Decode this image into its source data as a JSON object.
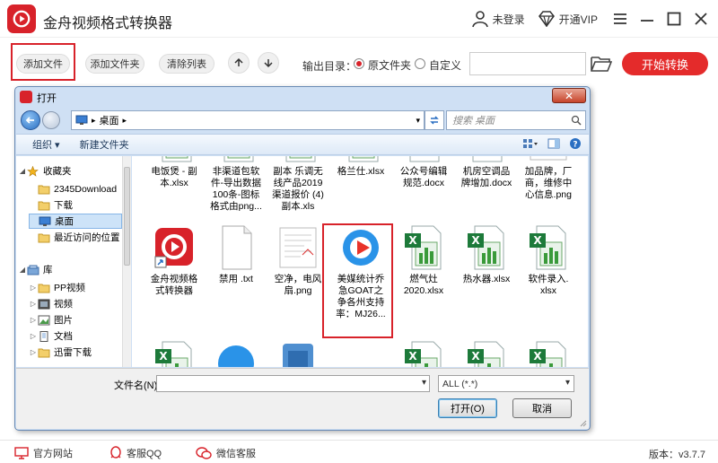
{
  "app": {
    "title": "金舟视频格式转换器",
    "login_label": "未登录",
    "vip_label": "开通VIP"
  },
  "toolbar": {
    "add_file": "添加文件",
    "add_folder": "添加文件夹",
    "clear_list": "清除列表",
    "output_label": "输出目录：",
    "radio_original": "原文件夹",
    "radio_custom": "自定义",
    "path_value": "",
    "start": "开始转换"
  },
  "dialog": {
    "title": "打开",
    "address": "桌面",
    "search_placeholder": "搜索 桌面",
    "organize": "组织 ▾",
    "new_folder": "新建文件夹",
    "nav": [
      {
        "label": "收藏夹",
        "level": 0,
        "expander": "◢"
      },
      {
        "label": "2345Download",
        "level": 1
      },
      {
        "label": "下载",
        "level": 1
      },
      {
        "label": "桌面",
        "level": 1,
        "selected": true
      },
      {
        "label": "最近访问的位置",
        "level": 1
      },
      {
        "label": "库",
        "level": 0,
        "expander": "◢"
      },
      {
        "label": "PP视频",
        "level": 1,
        "expander": "▷"
      },
      {
        "label": "视频",
        "level": 1,
        "expander": "▷"
      },
      {
        "label": "图片",
        "level": 1,
        "expander": "▷"
      },
      {
        "label": "文档",
        "level": 1,
        "expander": "▷"
      },
      {
        "label": "迅雷下载",
        "level": 1,
        "expander": "▷"
      }
    ],
    "files_row1": [
      {
        "label": "电饭煲 - 副\n本.xlsx",
        "type": "excel"
      },
      {
        "label": "非渠道包软\n件-导出数据\n100条-图标\n格式由png...",
        "type": "excel"
      },
      {
        "label": "副本 乐调无\n线产品2019\n渠道报价 (4)\n副本.xls",
        "type": "excel"
      },
      {
        "label": "格兰仕.xlsx",
        "type": "excel"
      },
      {
        "label": "公众号编辑\n规范.docx",
        "type": "word"
      },
      {
        "label": "机房空调品\n牌增加.docx",
        "type": "word"
      },
      {
        "label": "加品牌，厂\n商，维修中\n心信息.png",
        "type": "image"
      }
    ],
    "files_row2": [
      {
        "label": "金舟视频格\n式转换器",
        "type": "app"
      },
      {
        "label": "禁用 .txt",
        "type": "text"
      },
      {
        "label": "空净，电风\n扇.png",
        "type": "image"
      },
      {
        "label": "美媒统计乔\n急GOAT之\n争各州支持\n率：MJ26...",
        "type": "video"
      },
      {
        "label": "燃气灶\n2020.xlsx",
        "type": "excel"
      },
      {
        "label": "热水器.xlsx",
        "type": "excel"
      },
      {
        "label": "软件录入.\nxlsx",
        "type": "excel"
      }
    ],
    "filename_label": "文件名(N):",
    "filename_value": "",
    "filter": "ALL (*.*)",
    "open_btn": "打开(O)",
    "cancel_btn": "取消"
  },
  "statusbar": {
    "website": "官方网站",
    "qq": "客服QQ",
    "wechat": "微信客服",
    "version": "版本：v3.7.7"
  },
  "colors": {
    "brand": "#d8222a",
    "start": "#e42b2b"
  }
}
